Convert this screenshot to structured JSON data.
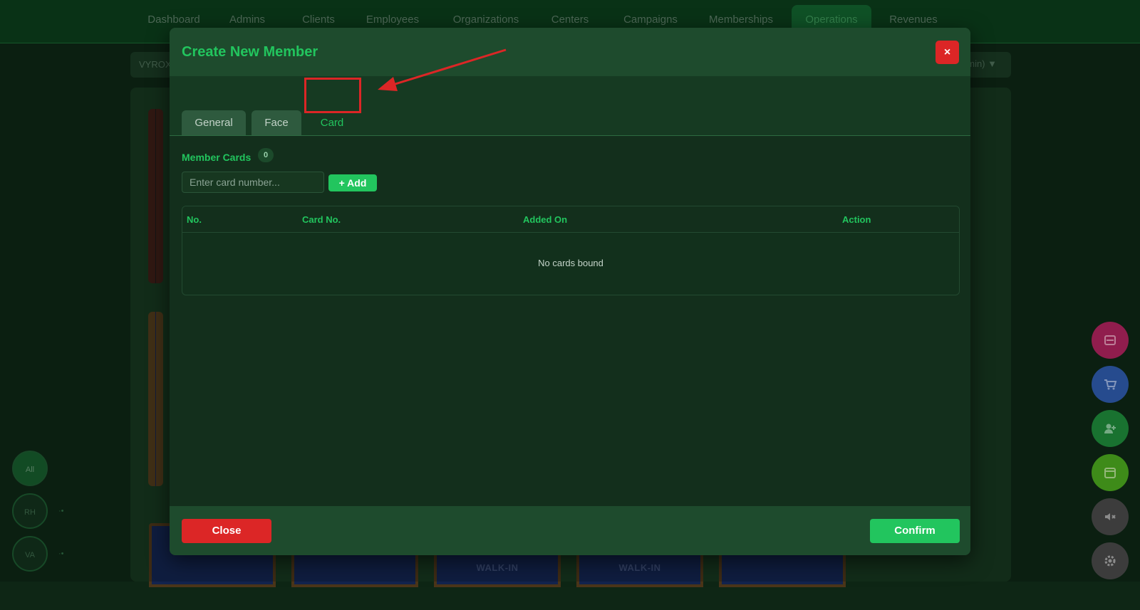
{
  "nav": {
    "items": [
      "Dashboard",
      "Admins",
      "Clients",
      "Employees",
      "Organizations",
      "Centers",
      "Campaigns",
      "Memberships",
      "Operations",
      "Revenues"
    ],
    "active": "Operations"
  },
  "filterbar": {
    "left_text": "VYROX",
    "right_text": "min)"
  },
  "side": {
    "all": "All",
    "rh": "RH",
    "va": "VA"
  },
  "walkin_label": "WALK-IN",
  "modal": {
    "title": "Create New Member",
    "close_x": "×",
    "tabs": [
      "General",
      "Face",
      "Card"
    ],
    "active_tab": "Card",
    "cards": {
      "label": "Member Cards",
      "count": "0",
      "input_placeholder": "Enter card number...",
      "add_label": "Add",
      "headers": [
        "No.",
        "Card No.",
        "Added On",
        "Action"
      ],
      "empty_text": "No cards bound"
    },
    "footer": {
      "close": "Close",
      "confirm": "Confirm"
    }
  },
  "colors": {
    "accent": "#22c55e",
    "danger": "#dc2626",
    "fab_colors": [
      "#b0245e",
      "#2f5cae",
      "#1f8c3b",
      "#4caa1f",
      "#4a4a4a",
      "#4a4a4a"
    ]
  },
  "fabs": [
    "scan-icon",
    "cart-icon",
    "add-user-icon",
    "calendar-icon",
    "mute-icon",
    "gear-icon"
  ]
}
